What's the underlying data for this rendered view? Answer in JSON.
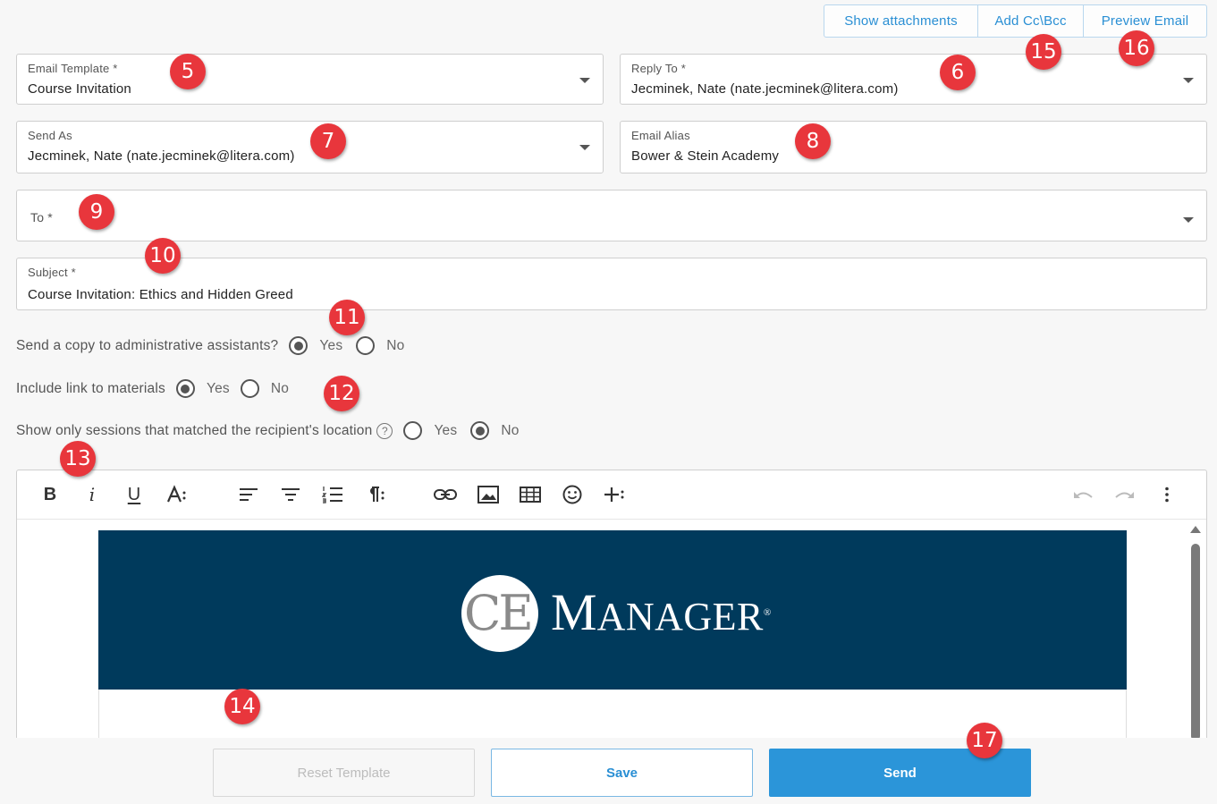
{
  "top_buttons": {
    "show_attachments": "Show attachments",
    "add_cc_bcc": "Add Cc\\Bcc",
    "preview_email": "Preview Email"
  },
  "fields": {
    "email_template": {
      "label": "Email Template  *",
      "value": "Course Invitation"
    },
    "reply_to": {
      "label": "Reply To  *",
      "value": "Jecminek, Nate (nate.jecminek@litera.com)"
    },
    "send_as": {
      "label": "Send As",
      "value": "Jecminek, Nate (nate.jecminek@litera.com)"
    },
    "email_alias": {
      "label": "Email Alias",
      "value": "Bower & Stein Academy"
    },
    "to": {
      "label": "To *",
      "value": ""
    },
    "subject": {
      "label": "Subject *",
      "value": "Course Invitation: Ethics and Hidden Greed"
    }
  },
  "options": {
    "copy_admin": {
      "question": "Send a copy to administrative assistants?",
      "yes": "Yes",
      "no": "No",
      "selected": "Yes"
    },
    "include_link": {
      "question": "Include link to materials",
      "yes": "Yes",
      "no": "No",
      "selected": "Yes"
    },
    "matched_location": {
      "question": "Show only sessions that matched the recipient's location",
      "help": "?",
      "yes": "Yes",
      "no": "No",
      "selected": "No"
    }
  },
  "editor": {
    "toolbar_icons": [
      "bold-icon",
      "italic-icon",
      "underline-icon",
      "font-size-icon",
      "align-left-icon",
      "align-center-icon",
      "ordered-list-icon",
      "paragraph-format-icon",
      "link-icon",
      "image-icon",
      "table-icon",
      "emoticon-icon",
      "insert-more-icon",
      "undo-icon",
      "redo-icon",
      "more-vertical-icon"
    ],
    "bold_glyph": "B",
    "italic_glyph": "i",
    "underline_glyph": "U",
    "banner_logo": {
      "mark": "CE",
      "word_big": "M",
      "word_rest": "ANAGER",
      "reg": "®"
    },
    "banner_color": "#003a5c"
  },
  "bottom_buttons": {
    "reset": "Reset Template",
    "save": "Save",
    "send": "Send"
  },
  "callouts": [
    "5",
    "6",
    "7",
    "8",
    "9",
    "10",
    "11",
    "12",
    "13",
    "14",
    "15",
    "16",
    "17"
  ],
  "colors": {
    "accent": "#2b95d9",
    "callout": "#e8363c"
  }
}
